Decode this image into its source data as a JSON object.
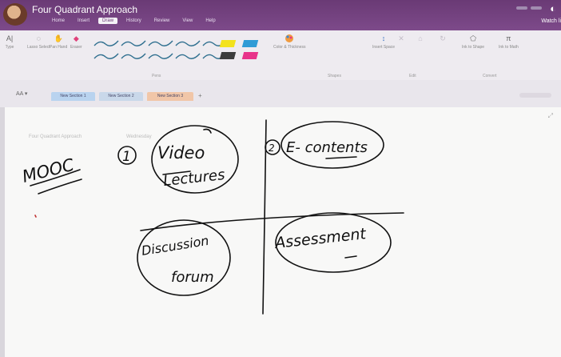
{
  "window": {
    "title": "Four Quadrant Approach",
    "clock_glyph": "◐",
    "watch_label": "Watch li"
  },
  "menu": [
    "Home",
    "Insert",
    "Draw",
    "History",
    "Review",
    "View",
    "Help"
  ],
  "menu_active": "Draw",
  "ribbon": {
    "tools": [
      {
        "label": "Type",
        "icon": "A|",
        "name": "type-tool"
      },
      {
        "label": "Lasso Select",
        "icon": "◌",
        "name": "lasso-select-tool"
      },
      {
        "label": "Pan Hand",
        "icon": "✋",
        "name": "pan-hand-tool"
      },
      {
        "label": "Eraser",
        "icon": "◆",
        "name": "eraser-tool"
      }
    ],
    "pens_group_label": "Pens",
    "color_thickness_label": "Color & Thickness",
    "shapes_label": "Shapes",
    "insert_space_label": "Insert Space",
    "edit_label": "Edit",
    "ink_to_shape_label": "Ink to Shape",
    "ink_to_math_label": "Ink to Math",
    "convert_label": "Convert",
    "colors": {
      "pen": "#2f6f8f",
      "highlight_yellow": "#f3e21c",
      "highlight_blue": "#2f9bd6",
      "highlight_pink": "#e8338a",
      "brand": "#7d4a8a"
    }
  },
  "notebook_selector": "AA",
  "sections": [
    "New Section 1",
    "New Section 2",
    "New Section 3"
  ],
  "active_section": "New Section 3",
  "page": {
    "title_text": "Four Quadrant Approach",
    "date_text": "Wednesday"
  },
  "handwriting": {
    "left_label": "MOOC",
    "q1_number": "1",
    "q1_line1": "Video",
    "q1_line2": "Lectures",
    "q2_number": "2",
    "q2_text": "E- contents",
    "q3_line1": "Discussion",
    "q3_line2": "forum",
    "q4_text": "Assessment"
  }
}
